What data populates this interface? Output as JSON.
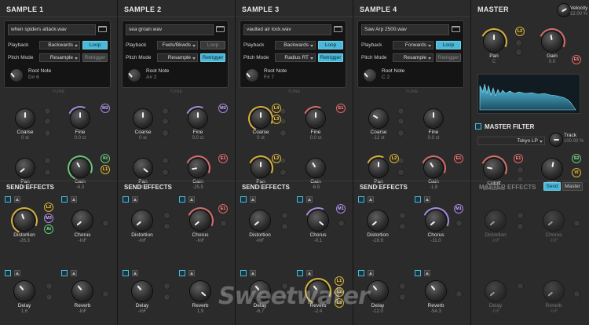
{
  "samples": [
    {
      "title": "SAMPLE 1",
      "file": "when spiders attack.wav",
      "playback": "Backwards",
      "loop": "Loop",
      "loop_on": true,
      "pitch_mode": "Resample",
      "retrigger": "Retrigger",
      "retrigger_on": false,
      "root_note_label": "Root Note",
      "root_note": "D# 6",
      "tune": "TUNE",
      "coarse": {
        "label": "Coarse",
        "value": "0 st"
      },
      "fine": {
        "label": "Fine",
        "value": "0.0 ct"
      },
      "pan": {
        "label": "Pan",
        "value": "100 L"
      },
      "gain": {
        "label": "Gain",
        "value": "-6.3"
      },
      "send_effects": "SEND EFFECTS",
      "distortion": {
        "label": "Distortion",
        "value": "-26.3"
      },
      "chorus": {
        "label": "Chorus",
        "value": "-InF"
      },
      "delay": {
        "label": "Delay",
        "value": "1.6"
      },
      "reverb": {
        "label": "Reverb",
        "value": "-InF"
      }
    },
    {
      "title": "SAMPLE 2",
      "file": "sea groan.wav",
      "playback": "Fwds/Bkwds",
      "loop": "Loop",
      "loop_on": false,
      "pitch_mode": "Resample",
      "retrigger": "Retrigger",
      "retrigger_on": true,
      "root_note_label": "Root Note",
      "root_note": "A# 2",
      "tune": "TUNE",
      "coarse": {
        "label": "Coarse",
        "value": "0 st"
      },
      "fine": {
        "label": "Fine",
        "value": "0.0 ct"
      },
      "pan": {
        "label": "Pan",
        "value": "100 R"
      },
      "gain": {
        "label": "Gain",
        "value": "-25.5"
      },
      "send_effects": "SEND EFFECTS",
      "distortion": {
        "label": "Distortion",
        "value": "-InF"
      },
      "chorus": {
        "label": "Chorus",
        "value": "-InF"
      },
      "delay": {
        "label": "Delay",
        "value": "-InF"
      },
      "reverb": {
        "label": "Reverb",
        "value": "1.9"
      }
    },
    {
      "title": "SAMPLE 3",
      "file": "vaulted air lock.wav",
      "playback": "Backwards",
      "loop": "Loop",
      "loop_on": true,
      "pitch_mode": "Radius RT",
      "retrigger": "Retrigger",
      "retrigger_on": true,
      "root_note_label": "Root Note",
      "root_note": "F# 7",
      "tune": "TUNE",
      "coarse": {
        "label": "Coarse",
        "value": "0 st"
      },
      "fine": {
        "label": "Fine",
        "value": "0.0 ct"
      },
      "pan": {
        "label": "Pan",
        "value": "C"
      },
      "gain": {
        "label": "Gain",
        "value": "-6.5"
      },
      "send_effects": "SEND EFFECTS",
      "distortion": {
        "label": "Distortion",
        "value": "-InF"
      },
      "chorus": {
        "label": "Chorus",
        "value": "-0.1"
      },
      "delay": {
        "label": "Delay",
        "value": "-6.7"
      },
      "reverb": {
        "label": "Reverb",
        "value": "-2.4"
      }
    },
    {
      "title": "SAMPLE 4",
      "file": "Saw Arp 2500.wav",
      "playback": "Forwards",
      "loop": "Loop",
      "loop_on": true,
      "pitch_mode": "Resample",
      "retrigger": "Retrigger",
      "retrigger_on": false,
      "root_note_label": "Root Note",
      "root_note": "C 2",
      "tune": "TUNE",
      "coarse": {
        "label": "Coarse",
        "value": "-12 st"
      },
      "fine": {
        "label": "Fine",
        "value": "0.0 ct"
      },
      "pan": {
        "label": "Pan",
        "value": "C"
      },
      "gain": {
        "label": "Gain",
        "value": "-1.8"
      },
      "send_effects": "SEND EFFECTS",
      "distortion": {
        "label": "Distortion",
        "value": "-18.9"
      },
      "chorus": {
        "label": "Chorus",
        "value": "-11.0"
      },
      "delay": {
        "label": "Delay",
        "value": "-12.0"
      },
      "reverb": {
        "label": "Reverb",
        "value": "-54.3"
      }
    }
  ],
  "labels": {
    "playback": "Playback",
    "pitch_mode": "Pitch Mode"
  },
  "master": {
    "title": "MASTER",
    "velocity": {
      "label": "Velocity",
      "value": "52.00 %"
    },
    "pan": {
      "label": "Pan",
      "value": "C"
    },
    "gain": {
      "label": "Gain",
      "value": "0.0"
    }
  },
  "master_filter": {
    "title": "MASTER FILTER",
    "type": "Tokyo LP",
    "track": {
      "label": "Track",
      "value": "100.00 %"
    },
    "cutoff": {
      "label": "Cutoff",
      "value": "204.21 Hz"
    },
    "res": {
      "label": "Res",
      "value": "0.64"
    }
  },
  "master_effects": {
    "title": "MASTER EFFECTS",
    "tab_send": "Send",
    "tab_master": "Master",
    "distortion": {
      "label": "Distortion",
      "value": "-InF"
    },
    "chorus": {
      "label": "Chorus",
      "value": "-InF"
    },
    "delay": {
      "label": "Delay",
      "value": "-InF"
    },
    "reverb": {
      "label": "Reverb",
      "value": "-InF"
    }
  },
  "watermark": "Sweetwater",
  "colors": {
    "accent": "#4cb8d9",
    "mod_m": "#a58ad9",
    "mod_l": "#d7b03a",
    "mod_e": "#d66c6c",
    "mod_k": "#6cc27a"
  }
}
